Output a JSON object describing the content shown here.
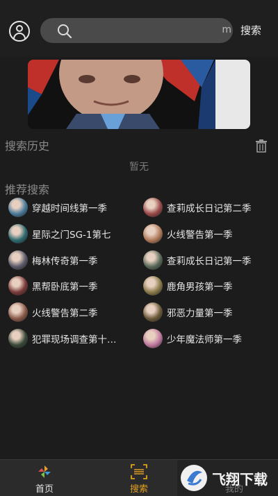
{
  "header": {
    "search_placeholder": "",
    "search_overflow_char": "m",
    "search_button": "搜索"
  },
  "history": {
    "title": "搜索历史",
    "empty_text": "暂无"
  },
  "recommend": {
    "title": "推荐搜索",
    "left": [
      {
        "label": "穿越时间线第一季",
        "color": "#4a7a9a"
      },
      {
        "label": "星际之门SG-1第七",
        "color": "#2f6a70"
      },
      {
        "label": "梅林传奇第一季",
        "color": "#5a5a6a"
      },
      {
        "label": "黑帮卧底第一季",
        "color": "#7a3a3a"
      },
      {
        "label": "火线警告第二季",
        "color": "#8a5a4a"
      },
      {
        "label": "犯罪现场调查第十…",
        "color": "#3a4a3a"
      }
    ],
    "right": [
      {
        "label": "查莉成长日记第二季",
        "color": "#9a4a4a"
      },
      {
        "label": "火线警告第一季",
        "color": "#b07a5a"
      },
      {
        "label": "查莉成长日记第一季",
        "color": "#5a6a5a"
      },
      {
        "label": "鹿角男孩第一季",
        "color": "#8a7a4a"
      },
      {
        "label": "邪恶力量第一季",
        "color": "#6a5a3a"
      },
      {
        "label": "少年魔法师第一季",
        "color": "#c07aa0"
      }
    ]
  },
  "tabs": [
    {
      "label": "首页",
      "color": "#e6e6e6"
    },
    {
      "label": "搜索",
      "color": "#e0a020"
    },
    {
      "label": "我的",
      "color": "#e6e6e6"
    }
  ],
  "watermark": "飞翔下载"
}
